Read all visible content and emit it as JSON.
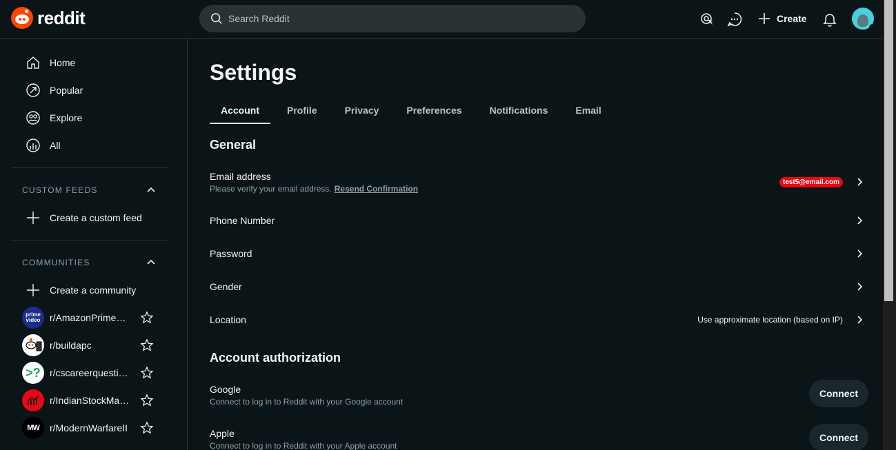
{
  "header": {
    "logo_text": "reddit",
    "search_placeholder": "Search Reddit",
    "create_label": "Create"
  },
  "sidebar": {
    "nav": [
      {
        "label": "Home",
        "icon": "home-icon"
      },
      {
        "label": "Popular",
        "icon": "popular-icon"
      },
      {
        "label": "Explore",
        "icon": "explore-icon"
      },
      {
        "label": "All",
        "icon": "all-icon"
      }
    ],
    "custom_feeds": {
      "title": "CUSTOM FEEDS",
      "create_label": "Create a custom feed"
    },
    "communities": {
      "title": "COMMUNITIES",
      "create_label": "Create a community",
      "items": [
        {
          "name": "r/AmazonPrimeVideo",
          "icon_text": "prime video",
          "color": "#1a2c8c"
        },
        {
          "name": "r/buildapc",
          "icon_text": "",
          "color": "#ffffff"
        },
        {
          "name": "r/cscareerquestions",
          "icon_text": ">?",
          "color": "#ffffff"
        },
        {
          "name": "r/IndianStockMarket",
          "icon_text": "",
          "color": "#e50914"
        },
        {
          "name": "r/ModernWarfareII",
          "icon_text": "MW",
          "color": "#000000"
        }
      ]
    }
  },
  "settings": {
    "title": "Settings",
    "tabs": [
      "Account",
      "Profile",
      "Privacy",
      "Preferences",
      "Notifications",
      "Email"
    ],
    "active_tab": "Account",
    "general": {
      "heading": "General",
      "email": {
        "label": "Email address",
        "sub": "Please verify your email address.",
        "link": "Resend Confirmation",
        "value": "test5@email.com"
      },
      "phone": {
        "label": "Phone Number"
      },
      "password": {
        "label": "Password"
      },
      "gender": {
        "label": "Gender"
      },
      "location": {
        "label": "Location",
        "value": "Use approximate location (based on IP)"
      }
    },
    "authorization": {
      "heading": "Account authorization",
      "google": {
        "label": "Google",
        "sub": "Connect to log in to Reddit with your Google account",
        "button": "Connect"
      },
      "apple": {
        "label": "Apple",
        "sub": "Connect to log in to Reddit with your Apple account",
        "button": "Connect"
      }
    }
  },
  "colors": {
    "background": "#0b1416",
    "accent": "#ff4500",
    "email_badge": "#e50914"
  }
}
